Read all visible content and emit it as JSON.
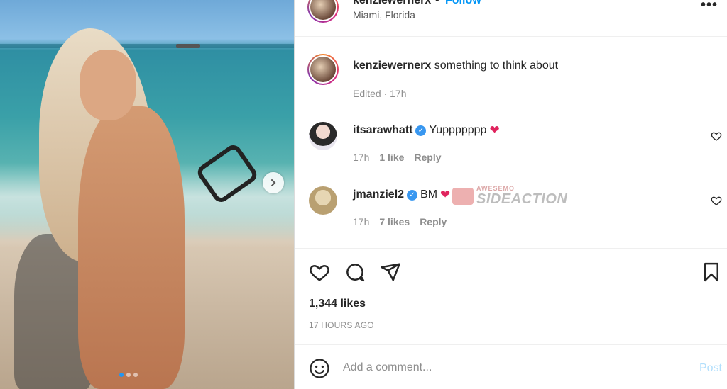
{
  "post": {
    "username": "kenziewernerx",
    "follow_label": "Follow",
    "separator": "•",
    "location": "Miami, Florida",
    "more_label": "•••",
    "caption_text": "something to think about",
    "caption_meta": "Edited · 17h",
    "likes": "1,344 likes",
    "time_ago": "17 HOURS AGO"
  },
  "comments": [
    {
      "username": "itsarawhatt",
      "text": "Yuppppppp",
      "time": "17h",
      "likes": "1 like",
      "reply": "Reply"
    },
    {
      "username": "jmanziel2",
      "text": "BM",
      "time": "17h",
      "likes": "7 likes",
      "reply": "Reply"
    }
  ],
  "watermark": {
    "top": "AWESEMO",
    "bottom": "SIDEACTION"
  },
  "add_comment": {
    "placeholder": "Add a comment...",
    "post_label": "Post"
  },
  "icons": {
    "heart": "heart-icon",
    "comment": "comment-icon",
    "share": "share-icon",
    "save": "bookmark-icon",
    "emoji": "emoji-icon",
    "next": "chevron-right-icon",
    "verified": "verified-badge-icon"
  },
  "colors": {
    "accent": "#0095f6",
    "post_disabled": "#b2dffc",
    "verified": "#3897f0",
    "red_heart": "#e0245e"
  },
  "carousel": {
    "slides": 3,
    "active": 1
  }
}
